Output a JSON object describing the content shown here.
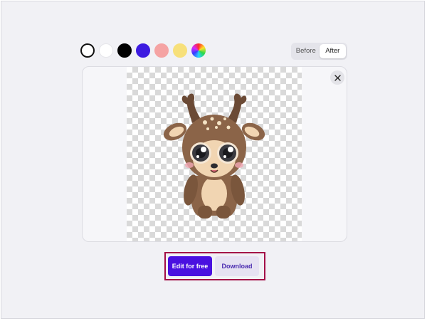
{
  "background_swatches": [
    {
      "name": "white-outline",
      "color": "#ffffff",
      "selected": true
    },
    {
      "name": "white",
      "color": "#ffffff"
    },
    {
      "name": "black",
      "color": "#000000"
    },
    {
      "name": "blue",
      "color": "#3d1be0"
    },
    {
      "name": "pink",
      "color": "#f5a3a3"
    },
    {
      "name": "yellow",
      "color": "#f7e07a"
    },
    {
      "name": "rainbow",
      "icon": "color-wheel-icon"
    }
  ],
  "view_toggle": {
    "before": "Before",
    "after": "After",
    "active": "after"
  },
  "preview": {
    "close_icon": "close-icon",
    "subject": "cartoon deer with transparent background"
  },
  "actions": {
    "edit_label": "Edit for free",
    "download_label": "Download"
  },
  "colors": {
    "accent": "#4a10e0",
    "highlight_border": "#a30d47"
  }
}
